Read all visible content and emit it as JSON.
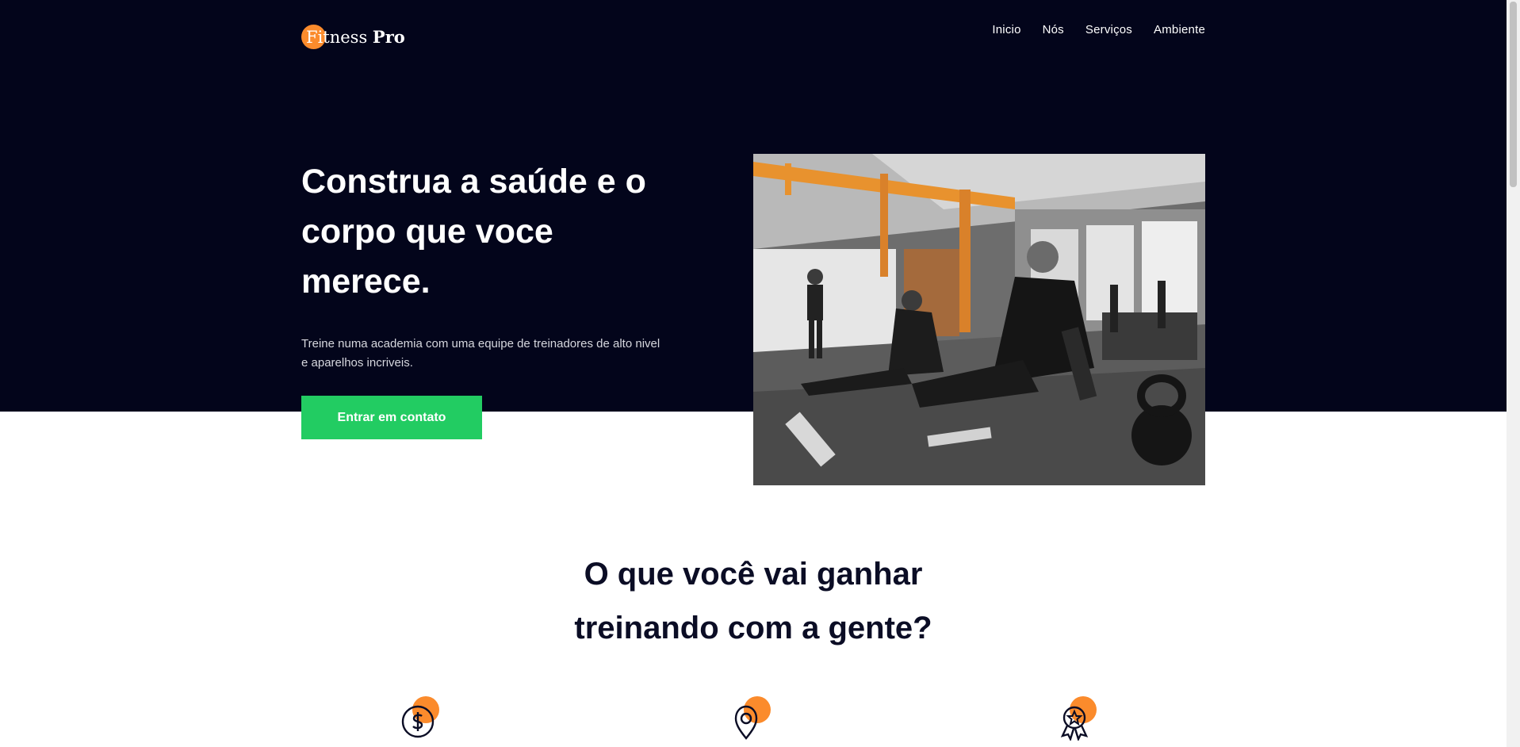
{
  "brand": {
    "name_regular": "Fitness",
    "name_bold": "Pro"
  },
  "nav": {
    "items": [
      "Inicio",
      "Nós",
      "Serviços",
      "Ambiente"
    ]
  },
  "hero": {
    "title": "Construa a saúde e o corpo que voce merece.",
    "subtitle": "Treine numa academia com uma equipe de treinadores de alto nivel e aparelhos incriveis.",
    "cta_label": "Entrar em contato",
    "image": "gym-training-photo"
  },
  "benefits": {
    "title_line1": "O que você vai ganhar",
    "title_line2": "treinando com a gente?",
    "icons": [
      "dollar-icon",
      "location-pin-icon",
      "award-badge-icon"
    ]
  },
  "colors": {
    "hero_background": "#03051b",
    "accent_orange": "#fb8b2c",
    "cta_green": "#22cc62",
    "heading_dark": "#0b0d25"
  }
}
